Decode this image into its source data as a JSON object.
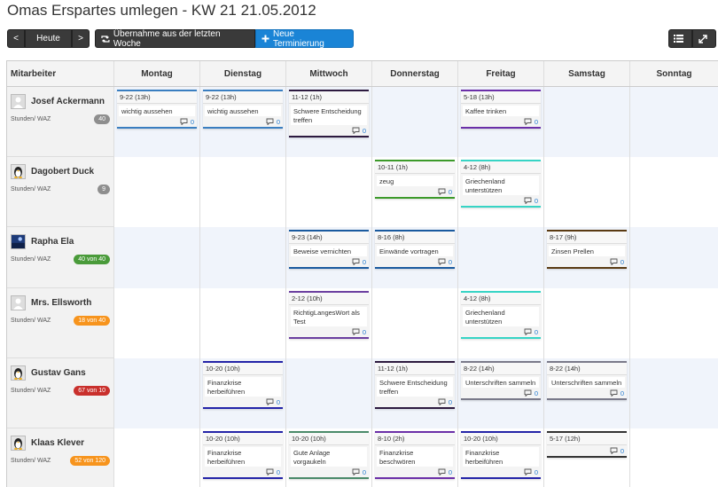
{
  "page": {
    "title": "Omas Erspartes umlegen - KW 21 21.05.2012"
  },
  "toolbar": {
    "prev_label": "<",
    "today_label": "Heute",
    "next_label": ">",
    "takeover_label": "Übernahme aus der letzten Woche",
    "new_label": "Neue Terminierung"
  },
  "colors": {
    "primary": "#1a84d6",
    "badge_gray": "#8e8e8e",
    "badge_green": "#4a9b3a",
    "badge_orange": "#f7941d",
    "badge_red": "#c9302c"
  },
  "table": {
    "employee_header": "Mitarbeiter",
    "days": [
      "Montag",
      "Dienstag",
      "Mittwoch",
      "Donnerstag",
      "Freitag",
      "Samstag",
      "Sonntag"
    ]
  },
  "employees": [
    {
      "name": "Josef Ackermann",
      "label": "Stunden/ WAZ",
      "badge": "40",
      "badge_color": "#8e8e8e",
      "avatar": "person-placeholder-icon",
      "events": [
        {
          "day": 0,
          "time": "9-22 (13h)",
          "title": "wichtig aussehen",
          "comments": "0",
          "color": "#3a7ec0"
        },
        {
          "day": 1,
          "time": "9-22 (13h)",
          "title": "wichtig aussehen",
          "comments": "0",
          "color": "#3a7ec0"
        },
        {
          "day": 2,
          "time": "11-12 (1h)",
          "title": "Schwere Entscheidung treffen",
          "comments": "0",
          "color": "#2d1a3f"
        },
        {
          "day": 4,
          "time": "5-18 (13h)",
          "title": "Kaffee trinken",
          "comments": "0",
          "color": "#6b2fa8"
        }
      ]
    },
    {
      "name": "Dagobert Duck",
      "label": "Stunden/ WAZ",
      "badge": "9",
      "badge_color": "#8e8e8e",
      "avatar": "penguin-avatar-icon",
      "events": [
        {
          "day": 3,
          "time": "10-11 (1h)",
          "title": "zeug",
          "comments": "0",
          "color": "#3c9a2a"
        },
        {
          "day": 4,
          "time": "4-12 (8h)",
          "title": "Griechenland unterstützen",
          "comments": "0",
          "color": "#37d4c5"
        }
      ]
    },
    {
      "name": "Rapha Ela",
      "label": "Stunden/ WAZ",
      "badge": "40 von 40",
      "badge_color": "#4a9b3a",
      "avatar": "photo-avatar-icon",
      "events": [
        {
          "day": 2,
          "time": "9-23 (14h)",
          "title": "Beweise vernichten",
          "comments": "0",
          "color": "#1a5a9e"
        },
        {
          "day": 3,
          "time": "8-16 (8h)",
          "title": "Einwände vortragen",
          "comments": "0",
          "color": "#1a5a9e"
        },
        {
          "day": 5,
          "time": "8-17 (9h)",
          "title": "Zinsen Prellen",
          "comments": "0",
          "color": "#5a3a12"
        }
      ]
    },
    {
      "name": "Mrs. Ellsworth",
      "label": "Stunden/ WAZ",
      "badge": "18 von 40",
      "badge_color": "#f7941d",
      "avatar": "person-placeholder-icon",
      "events": [
        {
          "day": 2,
          "time": "2-12 (10h)",
          "title": "RichtigLangesWort als Test",
          "comments": "0",
          "color": "#6b3fa0"
        },
        {
          "day": 4,
          "time": "4-12 (8h)",
          "title": "Griechenland unterstützen",
          "comments": "0",
          "color": "#37d4c5"
        }
      ]
    },
    {
      "name": "Gustav Gans",
      "label": "Stunden/ WAZ",
      "badge": "67 von 10",
      "badge_color": "#c9302c",
      "avatar": "penguin-avatar-icon",
      "events": [
        {
          "day": 1,
          "time": "10-20 (10h)",
          "title": "Finanzkrise herbeiführen",
          "comments": "0",
          "color": "#2424a8"
        },
        {
          "day": 3,
          "time": "11-12 (1h)",
          "title": "Schwere Entscheidung treffen",
          "comments": "0",
          "color": "#2d1a3f"
        },
        {
          "day": 4,
          "time": "8-22 (14h)",
          "title": "Unterschriften sammeln",
          "comments": "0",
          "color": "#7a7a8a"
        },
        {
          "day": 5,
          "time": "8-22 (14h)",
          "title": "Unterschriften sammeln",
          "comments": "0",
          "color": "#7a7a8a"
        }
      ]
    },
    {
      "name": "Klaas Klever",
      "label": "Stunden/ WAZ",
      "badge": "52 von 120",
      "badge_color": "#f7941d",
      "avatar": "penguin-avatar-icon",
      "events": [
        {
          "day": 1,
          "time": "10-20 (10h)",
          "title": "Finanzkrise herbeiführen",
          "comments": "0",
          "color": "#2424a8"
        },
        {
          "day": 2,
          "time": "10-20 (10h)",
          "title": "Gute Anlage vorgaukeln",
          "comments": "0",
          "color": "#4a8a6a"
        },
        {
          "day": 3,
          "time": "8-10 (2h)",
          "title": "Finanzkrise beschwören",
          "comments": "0",
          "color": "#6b2fa8"
        },
        {
          "day": 4,
          "time": "10-20 (10h)",
          "title": "Finanzkrise herbeiführen",
          "comments": "0",
          "color": "#2424a8"
        },
        {
          "day": 5,
          "time": "5-17 (12h)",
          "title": "",
          "comments": "0",
          "color": "#333333"
        }
      ]
    }
  ]
}
